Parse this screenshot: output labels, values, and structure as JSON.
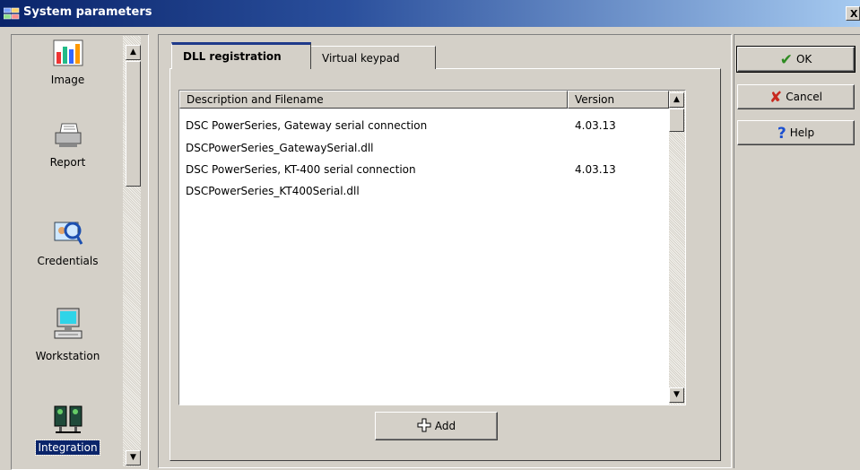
{
  "window": {
    "title": "System parameters",
    "close_glyph": "X",
    "app_icon": "grid-icon"
  },
  "sidebar": {
    "items": [
      {
        "label": "Image",
        "icon": "image-icon",
        "selected": false
      },
      {
        "label": "Report",
        "icon": "printer-icon",
        "selected": false
      },
      {
        "label": "Credentials",
        "icon": "credentials-icon",
        "selected": false
      },
      {
        "label": "Workstation",
        "icon": "computer-icon",
        "selected": false
      },
      {
        "label": "Integration",
        "icon": "integration-icon",
        "selected": true
      }
    ]
  },
  "tabs": [
    {
      "label": "DLL registration",
      "active": true
    },
    {
      "label": "Virtual keypad",
      "active": false
    }
  ],
  "list": {
    "columns": [
      "Description and Filename",
      "Version"
    ],
    "rows": [
      {
        "description": "DSC PowerSeries, Gateway serial connection",
        "version": "4.03.13"
      },
      {
        "description": "DSCPowerSeries_GatewaySerial.dll",
        "version": ""
      },
      {
        "description": "DSC PowerSeries, KT-400 serial connection",
        "version": "4.03.13"
      },
      {
        "description": "DSCPowerSeries_KT400Serial.dll",
        "version": ""
      }
    ]
  },
  "buttons": {
    "add": "Add",
    "ok": "OK",
    "cancel": "Cancel",
    "help": "Help"
  },
  "colors": {
    "titlebar_start": "#0a246a",
    "selection": "#0a246a",
    "ok_check": "#2e8b22",
    "cancel_x": "#c8281e",
    "help_q": "#1a4fd0"
  }
}
